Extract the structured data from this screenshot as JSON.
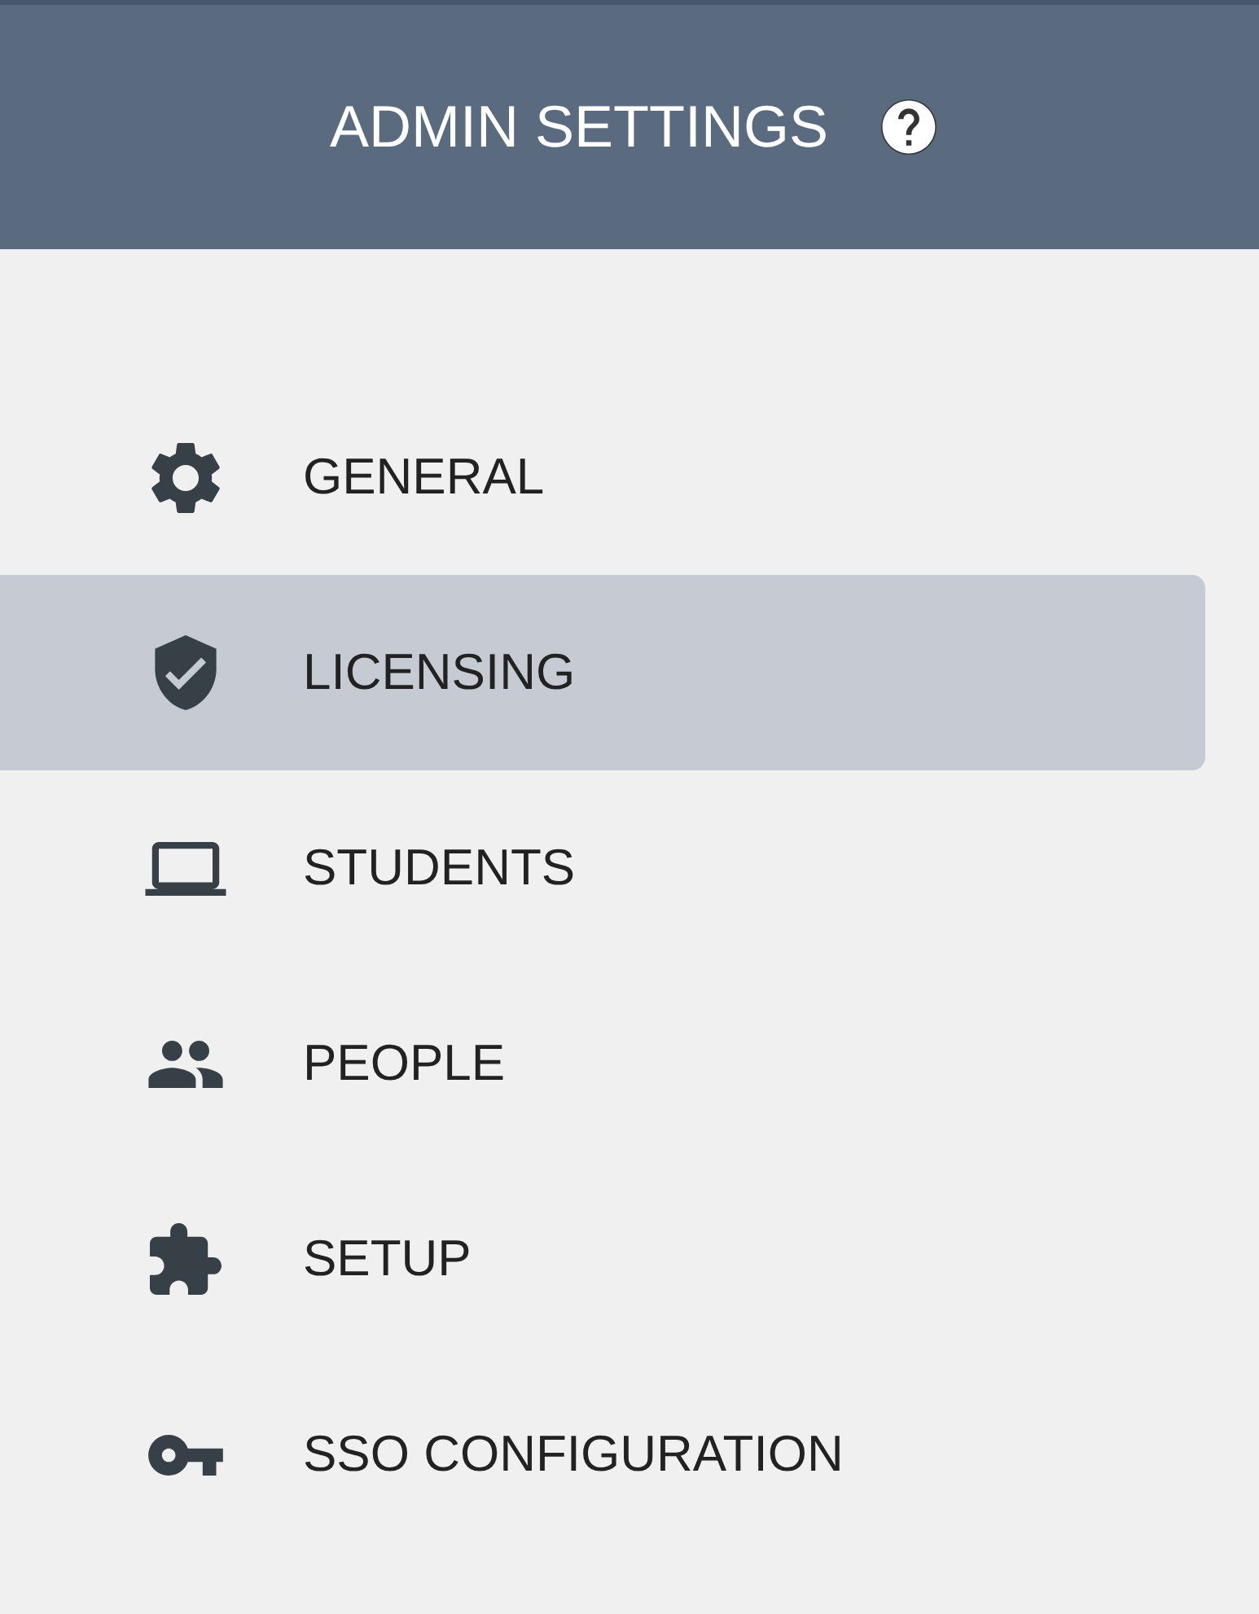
{
  "header": {
    "title": "ADMIN SETTINGS"
  },
  "menu": {
    "items": [
      {
        "label": "GENERAL",
        "selected": false
      },
      {
        "label": "LICENSING",
        "selected": true
      },
      {
        "label": "STUDENTS",
        "selected": false
      },
      {
        "label": "PEOPLE",
        "selected": false
      },
      {
        "label": "SETUP",
        "selected": false
      },
      {
        "label": "SSO CONFIGURATION",
        "selected": false
      }
    ]
  }
}
